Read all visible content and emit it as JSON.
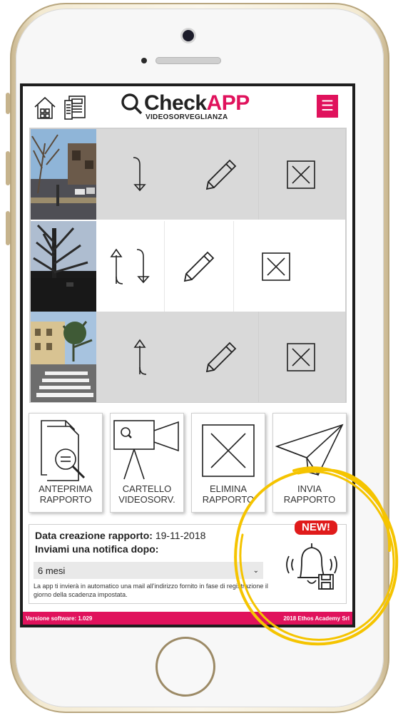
{
  "header": {
    "logo_main": "Check",
    "logo_accent": "APP",
    "logo_sub": "VIDEOSORVEGLIANZA",
    "menu_icon": "hamburger-icon",
    "home_icon": "home-icon",
    "doc_icon": "document-list-icon"
  },
  "rows": [
    {
      "photo": "street-photo-1",
      "arrows": "down",
      "edit_icon": "pencil-icon",
      "delete_icon": "close-box-icon"
    },
    {
      "photo": "tree-photo-2",
      "arrows": "up-down",
      "edit_icon": "pencil-icon",
      "delete_icon": "close-box-icon"
    },
    {
      "photo": "crosswalk-photo-3",
      "arrows": "up",
      "edit_icon": "pencil-icon",
      "delete_icon": "close-box-icon"
    }
  ],
  "actions": [
    {
      "line1": "ANTEPRIMA",
      "line2": "RAPPORTO",
      "icon": "preview-report-icon"
    },
    {
      "line1": "CARTELLO",
      "line2": "VIDEOSORV.",
      "icon": "camera-sign-icon"
    },
    {
      "line1": "ELIMINA",
      "line2": "RAPPORTO",
      "icon": "close-box-icon"
    },
    {
      "line1": "INVIA",
      "line2": "RAPPORTO",
      "icon": "paper-plane-icon"
    }
  ],
  "info": {
    "date_label": "Data creazione rapporto:",
    "date_value": "19-11-2018",
    "notify_label": "Inviami una notifica dopo:",
    "select_value": "6 mesi",
    "hint": "La app ti invierà in automatico una mail all'indirizzo fornito in fase di registrazione il giorno della scadenza impostata.",
    "badge": "NEW!",
    "bell_icon": "bell-save-icon"
  },
  "footer": {
    "version": "Versione software: 1.029",
    "copyright": "2018 Ethos Academy Srl"
  },
  "colors": {
    "accent": "#e0125c",
    "badge": "#e01b1b",
    "annotation": "#f5c400",
    "row_gray": "#d9d9d9"
  }
}
